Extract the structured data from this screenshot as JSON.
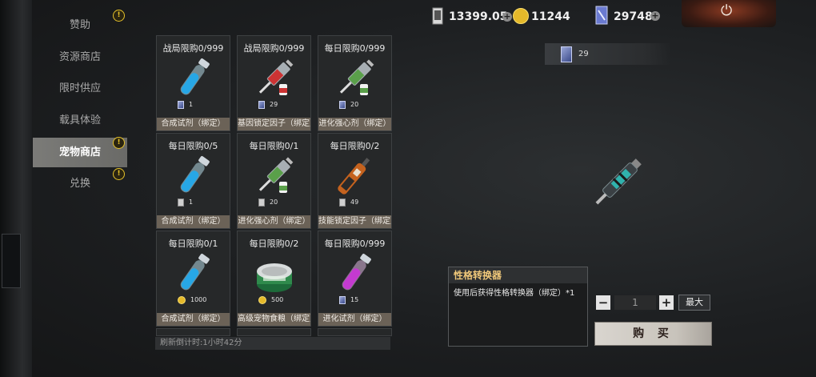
{
  "nav": {
    "items": [
      {
        "label": "赞助",
        "badge": "!"
      },
      {
        "label": "资源商店"
      },
      {
        "label": "限时供应"
      },
      {
        "label": "载具体验"
      },
      {
        "label": "宠物商店",
        "badge": "!",
        "active": true
      },
      {
        "label": "兑换",
        "badge": "!"
      }
    ]
  },
  "currencies": {
    "ticket": "13399.05",
    "coin": "11244",
    "card": "29748"
  },
  "grid": [
    {
      "limit": "战局限购0/999",
      "price": "1",
      "price_icon": "card-icon",
      "name": "合成试剂（绑定）",
      "item_icon": "blue-vial-icon"
    },
    {
      "limit": "战局限购0/999",
      "price": "29",
      "price_icon": "card-icon",
      "name": "基因锁定因子（绑定）",
      "item_icon": "red-syringe-icon"
    },
    {
      "limit": "每日限购0/999",
      "price": "20",
      "price_icon": "card-icon",
      "name": "进化强心剂（绑定）",
      "item_icon": "green-syringe-icon"
    },
    {
      "limit": "每日限购0/5",
      "price": "1",
      "price_icon": "ticket-icon",
      "name": "合成试剂（绑定）",
      "item_icon": "blue-vial-icon"
    },
    {
      "limit": "每日限购0/1",
      "price": "20",
      "price_icon": "ticket-icon",
      "name": "进化强心剂（绑定）",
      "item_icon": "green-syringe-icon"
    },
    {
      "limit": "每日限购0/2",
      "price": "49",
      "price_icon": "ticket-icon",
      "name": "技能锁定因子（绑定）",
      "item_icon": "orange-injector-icon"
    },
    {
      "limit": "每日限购0/1",
      "price": "1000",
      "price_icon": "coin-icon",
      "name": "合成试剂（绑定）",
      "item_icon": "blue-vial-icon"
    },
    {
      "limit": "每日限购0/2",
      "price": "500",
      "price_icon": "coin-icon",
      "name": "高级宠物食粮（绑定）",
      "item_icon": "pet-food-can-icon"
    },
    {
      "limit": "每日限购0/999",
      "price": "15",
      "price_icon": "card-icon",
      "name": "进化试剂（绑定）",
      "item_icon": "purple-vial-icon"
    }
  ],
  "refresh_text": "刷新倒计时:1小时42分",
  "owned_count": "29",
  "detail": {
    "title": "性格转换器",
    "description": "使用后获得性格转换器（绑定）*1"
  },
  "purchase": {
    "quantity": "1",
    "minus": "−",
    "plus": "+",
    "max_label": "最大",
    "buy_label": "购 买"
  },
  "colors": {
    "active_tab": "#6f6f6c",
    "item_name_bar": "#6b6257",
    "badge": "#e6c22a",
    "detail_title": "#f0c87a"
  }
}
